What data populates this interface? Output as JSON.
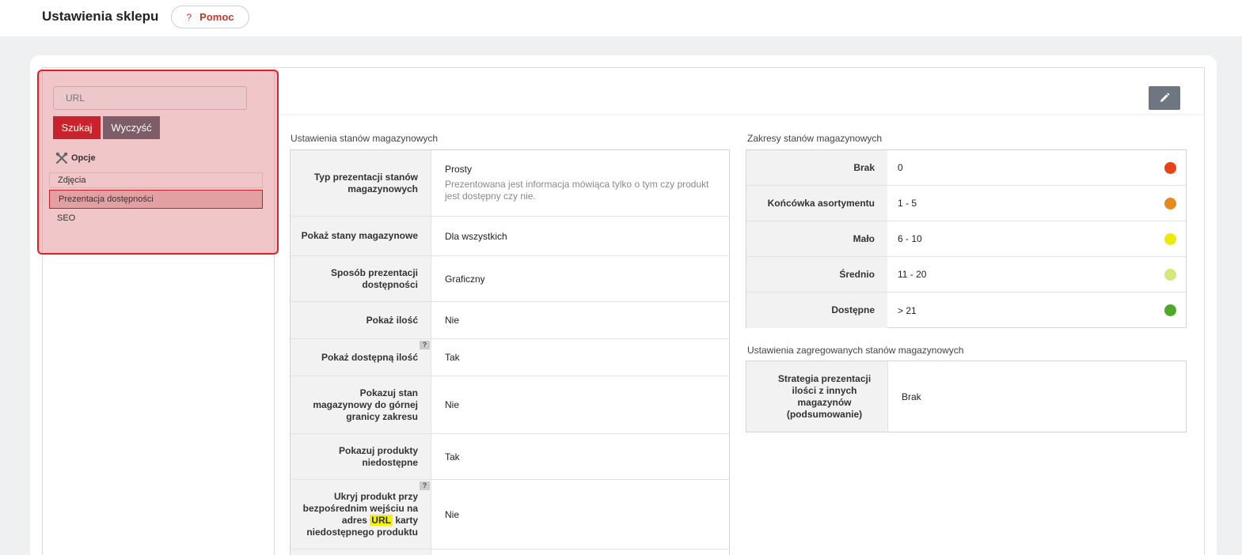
{
  "header": {
    "title": "Ustawienia sklepu",
    "help_icon": "?",
    "help_label": "Pomoc"
  },
  "sidebar": {
    "search_placeholder": "URL",
    "search_button": "Szukaj",
    "clear_button": "Wyczyść",
    "options_icon": "tools-icon",
    "options_label": "Opcje",
    "items": [
      {
        "label": "Zdjęcia"
      },
      {
        "label": "Prezentacja dostępności"
      },
      {
        "label": "SEO"
      }
    ]
  },
  "stock_settings": {
    "title": "Ustawienia stanów magazynowych",
    "rows": [
      {
        "label": "Typ prezentacji stanów magazynowych",
        "value": "Prosty",
        "desc": "Prezentowana jest informacja mówiąca tylko o tym czy produkt jest dostępny czy nie."
      },
      {
        "label": "Pokaż stany magazynowe",
        "value": "Dla wszystkich"
      },
      {
        "label": "Sposób prezentacji dostępności",
        "value": "Graficzny"
      },
      {
        "label": "Pokaż ilość",
        "value": "Nie"
      },
      {
        "label": "Pokaż dostępną ilość",
        "value": "Tak",
        "help": "?"
      },
      {
        "label": "Pokazuj stan magazynowy do górnej granicy zakresu",
        "value": "Nie"
      },
      {
        "label": "Pokazuj produkty niedostępne",
        "value": "Tak"
      },
      {
        "label_before": "Ukryj produkt przy bezpośrednim wejściu na adres",
        "label_highlight": "URL",
        "label_after": "karty niedostępnego produktu",
        "value": "Nie",
        "help": "?"
      }
    ]
  },
  "stock_ranges": {
    "title": "Zakresy stanów magazynowych",
    "rows": [
      {
        "label": "Brak",
        "value": "0",
        "color": "#e8421a"
      },
      {
        "label": "Końcówka asortymentu",
        "value": "1 - 5",
        "color": "#e8891e"
      },
      {
        "label": "Mało",
        "value": "6 - 10",
        "color": "#ece90e"
      },
      {
        "label": "Średnio",
        "value": "11 - 20",
        "color": "#d3e87a"
      },
      {
        "label": "Dostępne",
        "value": "> 21",
        "color": "#4fa82a"
      }
    ]
  },
  "aggregated": {
    "title": "Ustawienia zagregowanych stanów magazynowych",
    "label": "Strategia prezentacji ilości z innych magazynów (podsumowanie)",
    "value": "Brak"
  },
  "toolbar": {
    "edit_icon": "pencil-icon"
  }
}
